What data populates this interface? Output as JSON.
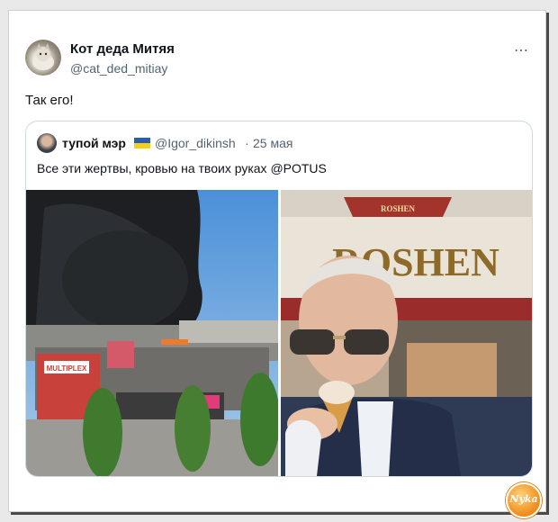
{
  "tweet": {
    "author_name": "Кот деда Митяя",
    "author_handle": "@cat_ded_mitiay",
    "more_icon": "⋯",
    "text": "Так его!"
  },
  "quote": {
    "author_name": "тупой мэр",
    "author_handle": "@Igor_dikinsh",
    "separator": "·",
    "date": "25 мая",
    "text": "Все эти жертвы, кровью на твоих руках @POTUS",
    "flag_colors": [
      "#2a5db0",
      "#f5d116"
    ]
  },
  "images": {
    "left_store_sign": "MULTIPLEX",
    "right_store_sign": "ROSHEN",
    "right_store_sign_top": "ROSHEN"
  },
  "watermark": "Nyka"
}
